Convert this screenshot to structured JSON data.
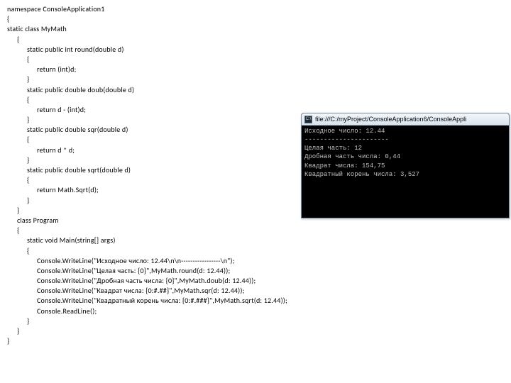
{
  "code": {
    "lines": [
      {
        "indent": 0,
        "text": "namespace ConsoleApplication1"
      },
      {
        "indent": 0,
        "text": "{"
      },
      {
        "indent": 0,
        "text": "static class MyMath"
      },
      {
        "indent": 1,
        "text": "{"
      },
      {
        "indent": 2,
        "text": "static public int round(double d)"
      },
      {
        "indent": 2,
        "text": "{"
      },
      {
        "indent": 3,
        "text": "return (int)d;"
      },
      {
        "indent": 2,
        "text": "}"
      },
      {
        "indent": 2,
        "text": "static public double doub(double d)"
      },
      {
        "indent": 2,
        "text": "{"
      },
      {
        "indent": 3,
        "text": "return d - (int)d;"
      },
      {
        "indent": 2,
        "text": "}"
      },
      {
        "indent": 2,
        "text": "static public double sqr(double d)"
      },
      {
        "indent": 2,
        "text": "{"
      },
      {
        "indent": 3,
        "text": "return d * d;"
      },
      {
        "indent": 2,
        "text": "}"
      },
      {
        "indent": 2,
        "text": "static public double sqrt(double d)"
      },
      {
        "indent": 2,
        "text": "{"
      },
      {
        "indent": 3,
        "text": "return Math.Sqrt(d);"
      },
      {
        "indent": 2,
        "text": "}"
      },
      {
        "indent": 1,
        "text": "}"
      },
      {
        "indent": 1,
        "text": "class Program"
      },
      {
        "indent": 1,
        "text": "{"
      },
      {
        "indent": 2,
        "text": "static void Main(string[] args)"
      },
      {
        "indent": 2,
        "text": "{"
      },
      {
        "indent": 3,
        "text": "Console.WriteLine(\"Исходное число: 12.44\\n\\n-----------------\\n\");"
      },
      {
        "indent": 3,
        "text": "Console.WriteLine(\"Целая часть: {0}\",MyMath.round(d: 12.44));"
      },
      {
        "indent": 3,
        "text": "Console.WriteLine(\"Дробная часть числа: {0}\",MyMath.doub(d: 12.44));"
      },
      {
        "indent": 3,
        "text": "Console.WriteLine(\"Квадрат числа: {0:#.##}\",MyMath.sqr(d: 12.44));"
      },
      {
        "indent": 3,
        "text": "Console.WriteLine(\"Квадратный корень числа: {0:#.###}\",MyMath.sqrt(d: 12.44));"
      },
      {
        "indent": 3,
        "text": "Console.ReadLine();"
      },
      {
        "indent": 2,
        "text": "}"
      },
      {
        "indent": 1,
        "text": "}"
      },
      {
        "indent": 0,
        "text": "}"
      }
    ]
  },
  "console": {
    "icon_text": "C:\\",
    "title": "file:///C:/myProject/ConsoleApplication6/ConsoleAppli",
    "output": [
      "Исходное число: 12.44",
      "----------------------",
      "",
      "Целая часть: 12",
      "Дробная часть числа: 0,44",
      "Квадрат числа: 154,75",
      "Квадратный корень числа: 3,527"
    ]
  }
}
